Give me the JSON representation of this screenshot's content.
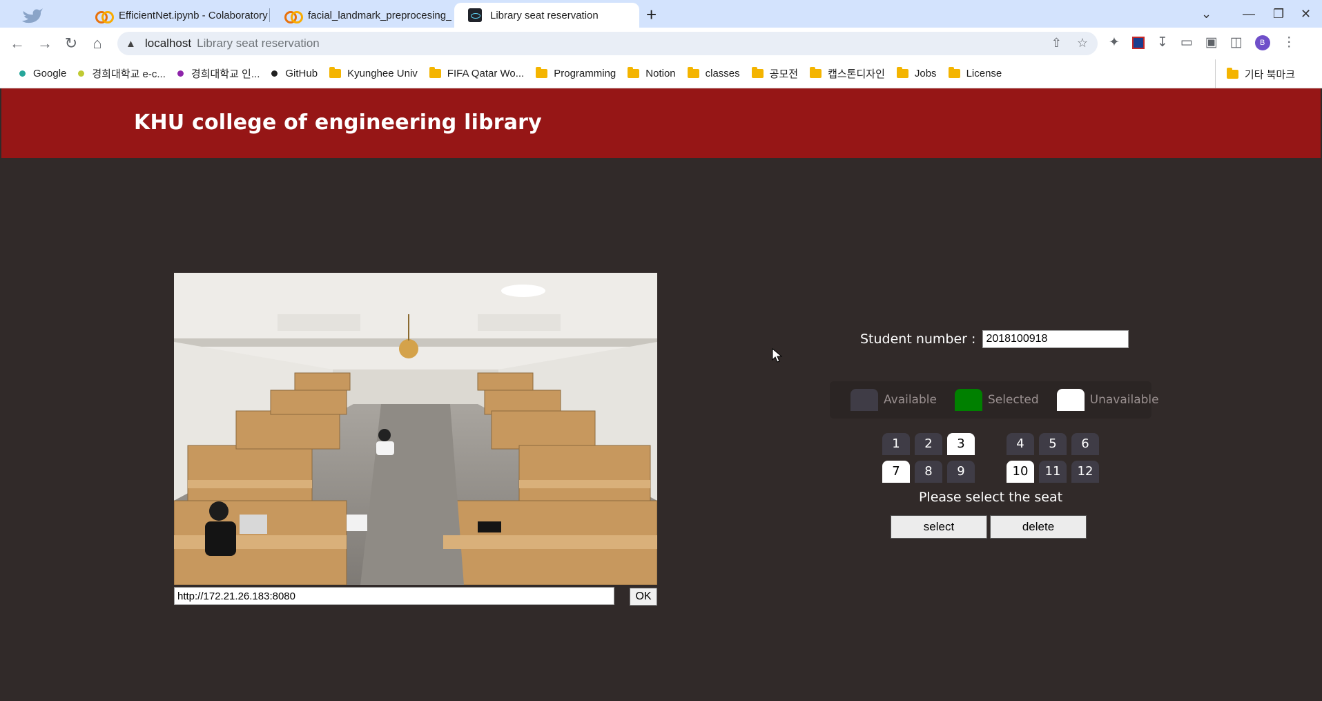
{
  "browser": {
    "tabs": [
      {
        "title": "EfficientNet.ipynb - Colaboratory",
        "favicon": "colab-icon"
      },
      {
        "title": "facial_landmark_preprocesing_fi",
        "favicon": "colab-icon"
      },
      {
        "title": "Library seat reservation",
        "favicon": "react-icon",
        "active": true
      }
    ],
    "new_tab": "+",
    "address": {
      "host": "localhost",
      "path": "Library seat reservation"
    },
    "bookmarks": [
      {
        "label": "Google",
        "type": "dot",
        "color": "#26a69a"
      },
      {
        "label": "경희대학교 e-c...",
        "type": "dot",
        "color": "#c0ca33"
      },
      {
        "label": "경희대학교 인...",
        "type": "dot",
        "color": "#8e24aa"
      },
      {
        "label": "GitHub",
        "type": "dot",
        "color": "#222222"
      },
      {
        "label": "Kyunghee Univ",
        "type": "folder"
      },
      {
        "label": "FIFA Qatar Wo...",
        "type": "folder"
      },
      {
        "label": "Programming",
        "type": "folder"
      },
      {
        "label": "Notion",
        "type": "folder"
      },
      {
        "label": "classes",
        "type": "folder"
      },
      {
        "label": "공모전",
        "type": "folder"
      },
      {
        "label": "캡스톤디자인",
        "type": "folder"
      },
      {
        "label": "Jobs",
        "type": "folder"
      },
      {
        "label": "License",
        "type": "folder"
      }
    ],
    "other_bookmarks": "기타 북마크",
    "profile_initial": "B"
  },
  "page": {
    "title": "KHU college of engineering library",
    "camera_url": "http://172.21.26.183:8080",
    "ok_label": "OK",
    "student_label": "Student number :",
    "student_number": "2018100918",
    "legend": {
      "available": "Available",
      "selected": "Selected",
      "unavailable": "Unavailable"
    },
    "seats": [
      {
        "number": "1",
        "status": "available"
      },
      {
        "number": "2",
        "status": "available"
      },
      {
        "number": "3",
        "status": "unavailable"
      },
      {
        "number": "4",
        "status": "available"
      },
      {
        "number": "5",
        "status": "available"
      },
      {
        "number": "6",
        "status": "available"
      },
      {
        "number": "7",
        "status": "unavailable"
      },
      {
        "number": "8",
        "status": "available"
      },
      {
        "number": "9",
        "status": "available"
      },
      {
        "number": "10",
        "status": "unavailable"
      },
      {
        "number": "11",
        "status": "available"
      },
      {
        "number": "12",
        "status": "available"
      }
    ],
    "prompt": "Please select the seat",
    "select_label": "select",
    "delete_label": "delete"
  },
  "colors": {
    "header": "#961616",
    "background": "#312a29",
    "available": "#3f3c46",
    "selected": "#008000",
    "unavailable": "#ffffff"
  }
}
